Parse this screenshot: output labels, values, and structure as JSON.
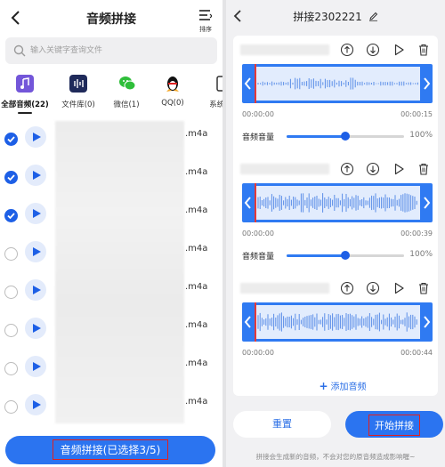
{
  "left": {
    "title": "音频拼接",
    "sort_label": "排序",
    "search_placeholder": "输入关键字查询文件",
    "categories": [
      {
        "label": "全部音频(22)",
        "icon": "music-file-icon",
        "color": "#6a4fd6"
      },
      {
        "label": "文件库(0)",
        "icon": "waveform-folder-icon",
        "color": "#1f2a5a"
      },
      {
        "label": "微信(1)",
        "icon": "wechat-icon",
        "color": "#2fbe3a"
      },
      {
        "label": "QQ(0)",
        "icon": "qq-penguin-icon",
        "color": "#111111"
      },
      {
        "label": "系统录",
        "icon": "system-recorder-icon",
        "color": "#333333"
      }
    ],
    "files": [
      {
        "ext": ".m4a",
        "checked": true
      },
      {
        "ext": ".m4a",
        "checked": true
      },
      {
        "ext": ".m4a",
        "checked": true
      },
      {
        "ext": ".m4a",
        "checked": false
      },
      {
        "ext": ".m4a",
        "checked": false
      },
      {
        "ext": ".m4a",
        "checked": false
      },
      {
        "ext": ".m4a",
        "checked": false
      },
      {
        "ext": ".m4a",
        "checked": false
      }
    ],
    "merge_button": "音频拼接(已选择3/5)"
  },
  "right": {
    "title": "拼接2302221",
    "clips": [
      {
        "start": "00:00:00",
        "end": "00:00:15",
        "volume_label": "音频音量",
        "volume_pct": "100%",
        "volume_level": 0.5
      },
      {
        "start": "00:00:00",
        "end": "00:00:39",
        "volume_label": "音频音量",
        "volume_pct": "100%",
        "volume_level": 0.5
      },
      {
        "start": "00:00:00",
        "end": "00:00:44",
        "volume_label": "",
        "volume_pct": "",
        "volume_level": 0.5
      }
    ],
    "add_audio": "添加音频",
    "reset": "重置",
    "start": "开始拼接",
    "note": "拼接会生成新的音频，不会对您的原音频造成影响喔~"
  },
  "colors": {
    "accent": "#2b74f0",
    "highlight_border": "#e02020",
    "wave_bg": "#e2ecfd"
  }
}
